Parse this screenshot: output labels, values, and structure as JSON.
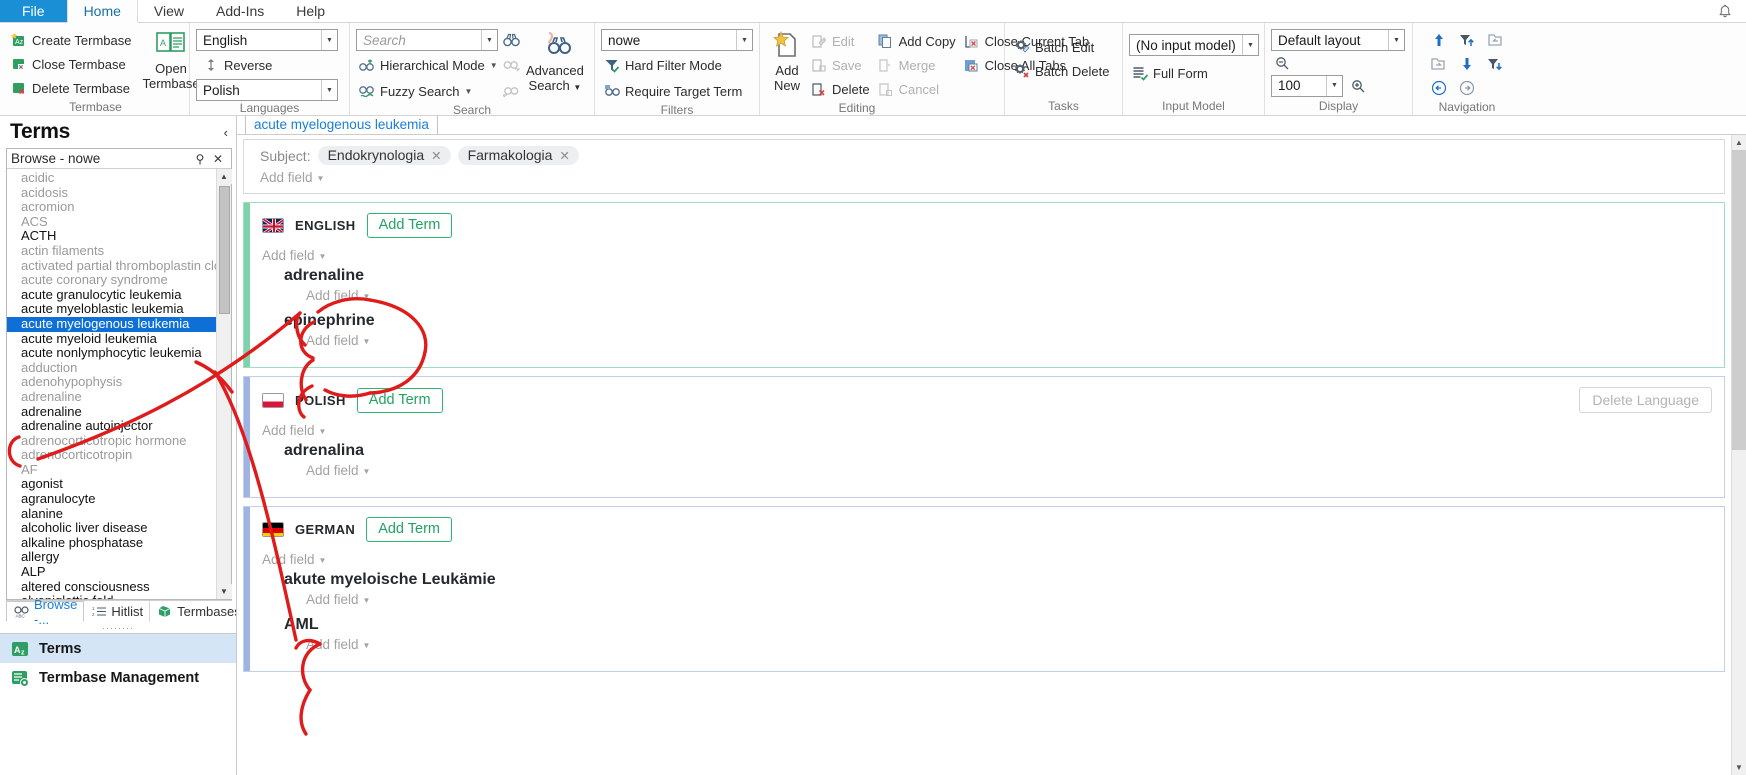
{
  "menubar": {
    "items": [
      {
        "label": "File",
        "active": false,
        "style": "file"
      },
      {
        "label": "Home",
        "active": true
      },
      {
        "label": "View",
        "active": false
      },
      {
        "label": "Add-Ins",
        "active": false
      },
      {
        "label": "Help",
        "active": false
      }
    ],
    "bell_icon": "bell-icon"
  },
  "ribbon": {
    "groups": [
      {
        "name": "Termbase",
        "label": "Termbase",
        "commands": [
          {
            "label": "Create Termbase",
            "icon": "create-termbase-icon",
            "disabled": false
          },
          {
            "label": "Close Termbase",
            "icon": "close-termbase-icon",
            "disabled": false
          },
          {
            "label": "Delete Termbase",
            "icon": "delete-termbase-icon",
            "disabled": false
          },
          {
            "label": "Open Termbase",
            "icon": "open-termbase-icon",
            "disabled": false,
            "big": true
          }
        ]
      },
      {
        "name": "Languages",
        "label": "Languages",
        "source_language": "English",
        "target_language": "Polish",
        "reverse_label": "Reverse",
        "reverse_icon": "reverse-arrows-icon"
      },
      {
        "name": "Search",
        "label": "Search",
        "search_placeholder": "Search",
        "search_value": "",
        "hierarchical_label": "Hierarchical Mode",
        "fuzzy_label": "Fuzzy Search",
        "advanced_label_line1": "Advanced",
        "advanced_label_line2": "Search"
      },
      {
        "name": "Filters",
        "label": "Filters",
        "filter_value": "nowe",
        "hard_filter_label": "Hard Filter Mode",
        "require_target_label": "Require Target Term"
      },
      {
        "name": "Editing",
        "label": "Editing",
        "add_new_line1": "Add",
        "add_new_line2": "New",
        "commands": [
          {
            "label": "Edit",
            "disabled": true,
            "icon": "edit-icon"
          },
          {
            "label": "Save",
            "disabled": true,
            "icon": "save-icon"
          },
          {
            "label": "Delete",
            "disabled": false,
            "icon": "delete-entry-icon"
          },
          {
            "label": "Add Copy",
            "disabled": false,
            "icon": "add-copy-icon"
          },
          {
            "label": "Merge",
            "disabled": true,
            "icon": "merge-icon"
          },
          {
            "label": "Cancel",
            "disabled": true,
            "icon": "cancel-icon"
          },
          {
            "label": "Close Current Tab",
            "disabled": false,
            "icon": "close-current-tab-icon"
          },
          {
            "label": "Close All Tabs",
            "disabled": false,
            "icon": "close-all-tabs-icon"
          }
        ]
      },
      {
        "name": "Tasks",
        "label": "Tasks",
        "batch_edit_label": "Batch Edit",
        "batch_delete_label": "Batch Delete"
      },
      {
        "name": "InputModel",
        "label": "Input Model",
        "input_model_value": "(No input model)",
        "full_form_label": "Full Form"
      },
      {
        "name": "Display",
        "label": "Display",
        "layout_value": "Default layout",
        "zoom_value": "100",
        "zoom_out_icon": "zoom-out-icon",
        "zoom_in_icon": "zoom-in-icon"
      },
      {
        "name": "Navigation",
        "label": "Navigation",
        "buttons": [
          {
            "icon": "arrow-up-icon"
          },
          {
            "icon": "filter-up-icon"
          },
          {
            "icon": "entry-prev-icon"
          },
          {
            "icon": "entry-next-icon"
          },
          {
            "icon": "arrow-down-icon"
          },
          {
            "icon": "filter-down-icon"
          },
          {
            "icon": "back-circle-icon"
          },
          {
            "icon": "forward-circle-icon"
          }
        ]
      }
    ]
  },
  "sidebar": {
    "title": "Terms",
    "collapse_icon": "chevron-left-icon",
    "panel": {
      "title": "Browse - nowe",
      "pin_icon": "pin-icon",
      "close_icon": "close-icon"
    },
    "terms": [
      {
        "text": "acidic",
        "state": "dim"
      },
      {
        "text": "acidosis",
        "state": "dim"
      },
      {
        "text": "acromion",
        "state": "dim"
      },
      {
        "text": "ACS",
        "state": "dim"
      },
      {
        "text": "ACTH",
        "state": "normal"
      },
      {
        "text": "actin filaments",
        "state": "dim"
      },
      {
        "text": "activated partial thromboplastin clottin",
        "state": "dim"
      },
      {
        "text": "acute coronary syndrome",
        "state": "dim"
      },
      {
        "text": "acute granulocytic leukemia",
        "state": "normal"
      },
      {
        "text": "acute myeloblastic leukemia",
        "state": "normal"
      },
      {
        "text": "acute myelogenous leukemia",
        "state": "selected"
      },
      {
        "text": "acute myeloid leukemia",
        "state": "normal"
      },
      {
        "text": "acute nonlymphocytic leukemia",
        "state": "normal"
      },
      {
        "text": "adduction",
        "state": "dim"
      },
      {
        "text": "adenohypophysis",
        "state": "dim"
      },
      {
        "text": "adrenaline",
        "state": "dim"
      },
      {
        "text": "adrenaline",
        "state": "normal"
      },
      {
        "text": "adrenaline autoinjector",
        "state": "normal"
      },
      {
        "text": "adrenocorticotropic hormone",
        "state": "dim"
      },
      {
        "text": "adrenocorticotropin",
        "state": "dim"
      },
      {
        "text": "AF",
        "state": "dim"
      },
      {
        "text": "agonist",
        "state": "normal"
      },
      {
        "text": "agranulocyte",
        "state": "normal"
      },
      {
        "text": "alanine",
        "state": "normal"
      },
      {
        "text": "alcoholic liver disease",
        "state": "normal"
      },
      {
        "text": "alkaline phosphatase",
        "state": "normal"
      },
      {
        "text": "allergy",
        "state": "normal"
      },
      {
        "text": "ALP",
        "state": "normal"
      },
      {
        "text": "altered consciousness",
        "state": "normal"
      },
      {
        "text": "alyepiglottic fold",
        "state": "normal"
      }
    ],
    "bottom_tabs": [
      {
        "label": "Browse -...",
        "icon": "browse-icon",
        "active": true
      },
      {
        "label": "Hitlist",
        "icon": "hitlist-icon",
        "active": false
      },
      {
        "label": "Termbases",
        "icon": "termbases-icon",
        "active": false
      }
    ],
    "nav_items": [
      {
        "label": "Terms",
        "icon": "terms-nav-icon",
        "active": true
      },
      {
        "label": "Termbase Management",
        "icon": "termbase-management-icon",
        "active": false
      }
    ]
  },
  "content": {
    "tab_label": "acute myelogenous leukemia",
    "header": {
      "subject_label": "Subject:",
      "subjects": [
        "Endokrynologia",
        "Farmakologia"
      ],
      "chip_remove_icon": "chip-remove-icon",
      "add_field_label": "Add field"
    },
    "add_field_label": "Add field",
    "add_term_label": "Add Term",
    "delete_language_label": "Delete Language",
    "languages": [
      {
        "name": "ENGLISH",
        "flag": "uk-flag-icon",
        "accent": "#7fd3ac",
        "show_delete_language": false,
        "terms": [
          "adrenaline",
          "epinephrine"
        ]
      },
      {
        "name": "POLISH",
        "flag": "poland-flag-icon",
        "accent": "#9fb4e0",
        "show_delete_language": true,
        "terms": [
          "adrenalina"
        ]
      },
      {
        "name": "GERMAN",
        "flag": "germany-flag-icon",
        "accent": "#9fb4e0",
        "show_delete_language": false,
        "terms": [
          "akute myeloische Leukämie",
          "AML"
        ]
      }
    ]
  },
  "annotations": {
    "ink_color": "#e01b1b",
    "description": "hand-drawn red pen marks linking sidebar terms to entry terms"
  }
}
